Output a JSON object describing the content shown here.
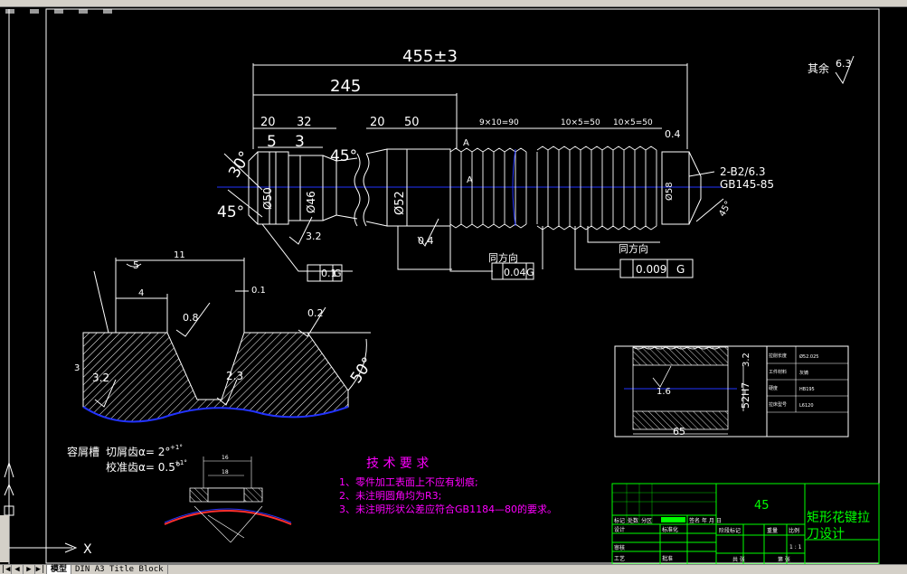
{
  "colors": {
    "background": "#000000",
    "line": "#ffffff",
    "centerline": "#2233ff",
    "hatch": "#ffffff",
    "notes": "#ff00ff",
    "titleblock": "#00ff00",
    "green_label": "#00ff00"
  },
  "dimensions": {
    "overall": "455±3",
    "d245": "245",
    "d20a": "20",
    "d32": "32",
    "d5": "5",
    "d3": "3",
    "d20b": "20",
    "d50": "50",
    "d9x10": "9×10=90",
    "d10x5a": "10×5=50",
    "d10x5b": "10×5=50",
    "d04": "0.4",
    "d30": "30°",
    "d45a": "45°",
    "d45b": "45°",
    "d45c": "45°",
    "dia50": "Ø50",
    "dia46": "Ø46",
    "dia52": "Ø52",
    "dia58": "Ø58",
    "rough32": "3.2",
    "rough04": "0.4",
    "center_hole_a": "2-B2/6.3",
    "center_hole_b": "GB145-85",
    "letterA": "A",
    "letterA2": "A"
  },
  "tolerances": {
    "frame1_val": "0.1",
    "frame1_ref": "G",
    "same_dir_1": "同方向",
    "frame2_val": "0.04",
    "frame2_ref": "G",
    "same_dir_2": "同方向",
    "frame3_val": "0.009",
    "frame3_ref": "G"
  },
  "remainder": {
    "label": "其余",
    "value": "6.3"
  },
  "tooth_detail": {
    "d11": "11",
    "d5": "5",
    "d4": "4",
    "d01": "0.1",
    "r08": "0.8",
    "r02": "0.2",
    "d3": "3",
    "r32": "3.2",
    "d23": "2.3",
    "a50": "50°"
  },
  "chip_notes": {
    "label": "容屑槽",
    "cut_tooth": "切屑齿α= 2°",
    "cut_tol": "+1°",
    "calib_tooth": "校准齿α= 0.5°",
    "calib_tol": "+1°"
  },
  "small_section": {
    "d1": "16",
    "d2": "18"
  },
  "tech_requirements": {
    "title": "技 术 要 求",
    "items": [
      "1、零件加工表面上不应有划痕;",
      "2、未注明圆角均为R3;",
      "3、未注明形状公差应符合GB1184—80的要求。"
    ]
  },
  "bore_section": {
    "d52": "52H7",
    "r32": "3.2",
    "r16": "1.6",
    "d65": "65"
  },
  "params_table": [
    [
      "拉削长度",
      "Ø52.025"
    ],
    [
      "工件材料",
      "灰铸"
    ],
    [
      "硬度",
      "HB195"
    ],
    [
      "拉床型号",
      "L6120"
    ]
  ],
  "title_block": {
    "material": "45",
    "title_line1": "矩形花键拉",
    "title_line2": "刀设计",
    "row_labels": [
      "标记",
      "处数",
      "分区",
      "更改文件号",
      "签名",
      "年 月 日"
    ],
    "cells": [
      "设计",
      "标准化",
      "阶段标记",
      "重量",
      "比例",
      "审核",
      "工艺",
      "批准",
      "共 张",
      "第 张"
    ],
    "scale": "1 : 1"
  },
  "ucs": {
    "x": "X",
    "y": "Y"
  },
  "bottom_tabs": {
    "model": "模型",
    "layout": "DIN A3 Title Block"
  }
}
